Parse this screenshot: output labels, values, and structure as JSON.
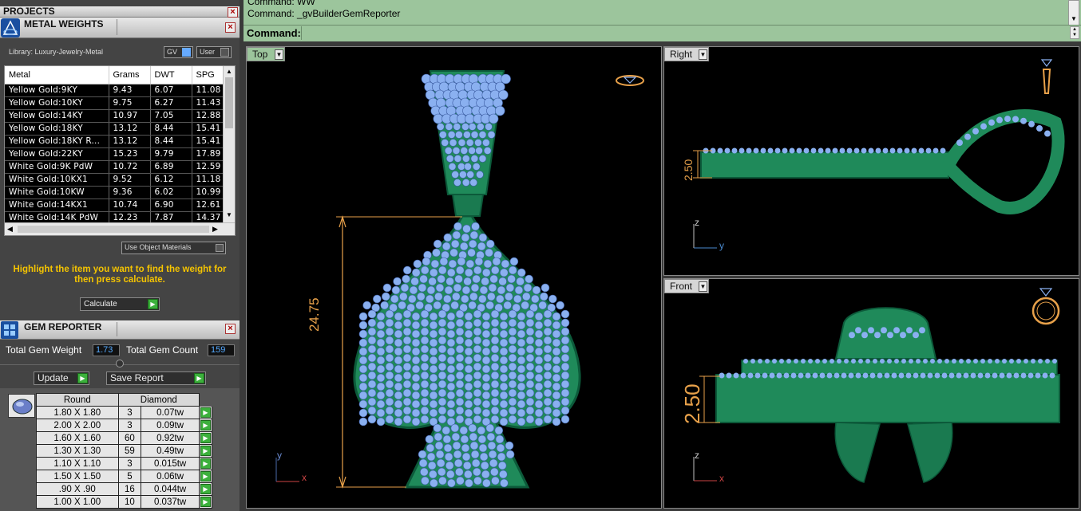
{
  "projects": {
    "title": "PROJECTS"
  },
  "metal_weights": {
    "title": "METAL WEIGHTS",
    "library": "Library: Luxury-Jewelry-Metal",
    "toggle_gv": "GV",
    "toggle_user": "User",
    "columns": [
      "Metal",
      "Grams",
      "DWT",
      "SPG"
    ],
    "rows": [
      [
        "Yellow Gold:9KY",
        "9.43",
        "6.07",
        "11.08"
      ],
      [
        "Yellow Gold:10KY",
        "9.75",
        "6.27",
        "11.43"
      ],
      [
        "Yellow Gold:14KY",
        "10.97",
        "7.05",
        "12.88"
      ],
      [
        "Yellow Gold:18KY",
        "13.12",
        "8.44",
        "15.41"
      ],
      [
        "Yellow Gold:18KY R...",
        "13.12",
        "8.44",
        "15.41"
      ],
      [
        "Yellow Gold:22KY",
        "15.23",
        "9.79",
        "17.89"
      ],
      [
        "White Gold:9K PdW",
        "10.72",
        "6.89",
        "12.59"
      ],
      [
        "White Gold:10KX1",
        "9.52",
        "6.12",
        "11.18"
      ],
      [
        "White Gold:10KW",
        "9.36",
        "6.02",
        "10.99"
      ],
      [
        "White Gold:14KX1",
        "10.74",
        "6.90",
        "12.61"
      ],
      [
        "White Gold:14K PdW",
        "12.23",
        "7.87",
        "14.37"
      ]
    ],
    "use_object_materials": "Use Object Materials",
    "instruction": "Highlight the item you want to find the weight for then press calculate.",
    "calculate": "Calculate"
  },
  "gem_reporter": {
    "title": "GEM REPORTER",
    "total_weight_label": "Total Gem Weight",
    "total_weight": "1.73",
    "total_count_label": "Total Gem Count",
    "total_count": "159",
    "update": "Update",
    "save_report": "Save Report",
    "shape": "Round",
    "material": "Diamond",
    "rows": [
      [
        "1.80 X 1.80",
        "3",
        "0.07tw"
      ],
      [
        "2.00 X 2.00",
        "3",
        "0.09tw"
      ],
      [
        "1.60 X 1.60",
        "60",
        "0.92tw"
      ],
      [
        "1.30 X 1.30",
        "59",
        "0.49tw"
      ],
      [
        "1.10 X 1.10",
        "3",
        "0.015tw"
      ],
      [
        "1.50 X 1.50",
        "5",
        "0.06tw"
      ],
      [
        ".90 X .90",
        "16",
        "0.044tw"
      ],
      [
        "1.00 X 1.00",
        "10",
        "0.037tw"
      ]
    ]
  },
  "command": {
    "line1": "Command: WW",
    "line2": "Command: _gvBuilderGemReporter",
    "prompt": "Command:"
  },
  "viewports": {
    "top": {
      "label": "Top",
      "dimension": "24.75"
    },
    "right": {
      "label": "Right",
      "dimension": "2.50"
    },
    "front": {
      "label": "Front",
      "dimension": "2.50"
    },
    "axes": {
      "x": "x",
      "y": "y",
      "z": "z"
    }
  },
  "colors": {
    "accent_green": "#9cc59c",
    "model_green": "#1f8a5a",
    "gem_blue": "#8ab0f0",
    "dim_orange": "#e8a14a",
    "warn_yellow": "#f5c400"
  }
}
